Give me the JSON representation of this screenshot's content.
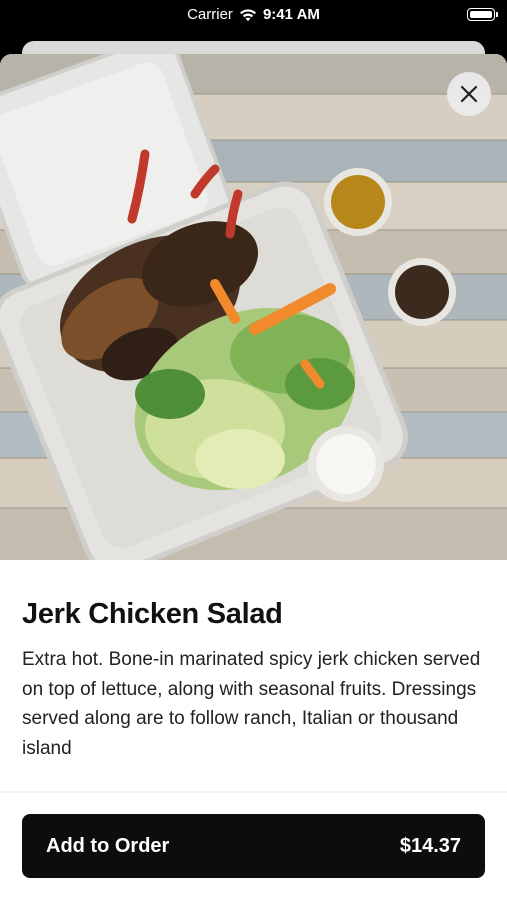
{
  "status_bar": {
    "carrier": "Carrier",
    "time": "9:41 AM"
  },
  "item": {
    "title": "Jerk Chicken Salad",
    "description": "Extra hot. Bone-in marinated spicy jerk chicken served on top of lettuce, along with seasonal fruits. Dressings served along are to follow ranch, Italian or thousand island"
  },
  "actions": {
    "add_label": "Add to Order",
    "price": "$14.37"
  },
  "icons": {
    "close": "close-icon",
    "wifi": "wifi-icon",
    "battery": "battery-icon"
  },
  "colors": {
    "button_bg": "#0d0d0d",
    "sheet_bg": "#ffffff",
    "backdrop": "#000000"
  }
}
